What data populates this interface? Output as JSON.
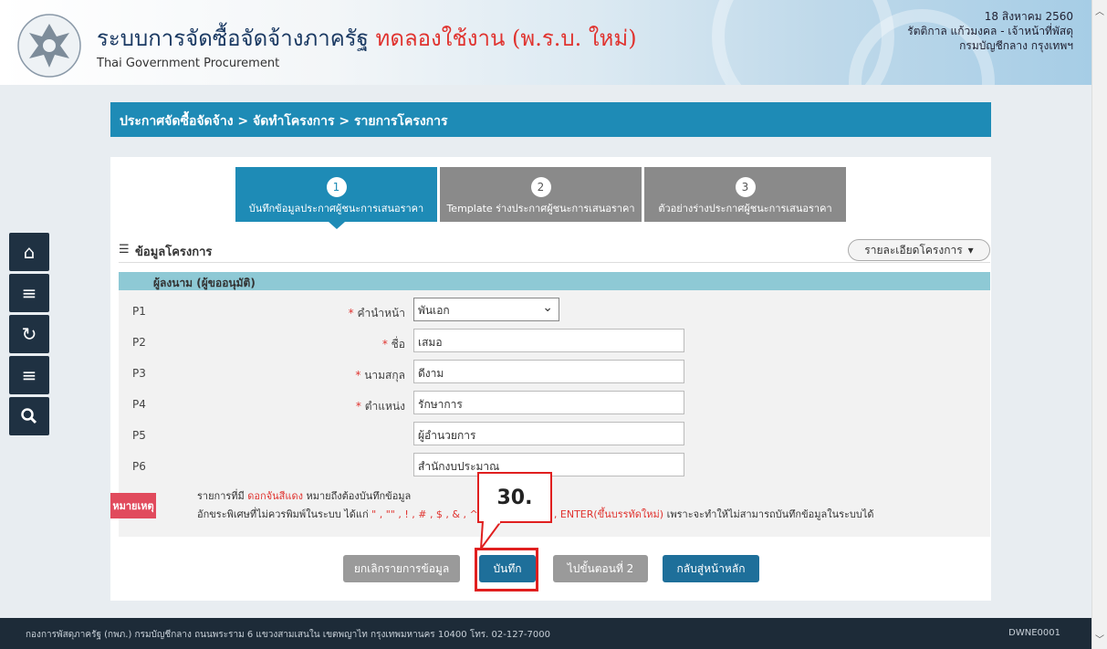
{
  "header": {
    "title": "ระบบการจัดซื้อจัดจ้างภาครัฐ",
    "trial_label": "ทดลองใช้งาน (พ.ร.บ. ใหม่)",
    "subtitle": "Thai Government Procurement",
    "date": "18 สิงหาคม 2560",
    "user": "รัตติกาล แก้วมงคล - เจ้าหน้าที่พัสดุ",
    "department": "กรมบัญชีกลาง กรุงเทพฯ"
  },
  "breadcrumb": "ประกาศจัดซื้อจัดจ้าง > จัดทำโครงการ > รายการโครงการ",
  "steps": [
    {
      "num": "1",
      "label": "บันทึกข้อมูลประกาศผู้ชนะการเสนอราคา"
    },
    {
      "num": "2",
      "label": "Template ร่างประกาศผู้ชนะการเสนอราคา"
    },
    {
      "num": "3",
      "label": "ตัวอย่างร่างประกาศผู้ชนะการเสนอราคา"
    }
  ],
  "section": {
    "title": "ข้อมูลโครงการ",
    "detail_button": "รายละเอียดโครงการ"
  },
  "form": {
    "panel_title": "ผู้ลงนาม (ผู้ขออนุมัติ)",
    "rows": [
      {
        "p": "P1",
        "label": "คำนำหน้า",
        "value": "พันเอก"
      },
      {
        "p": "P2",
        "label": "ชื่อ",
        "value": "เสมอ"
      },
      {
        "p": "P3",
        "label": "นามสกุล",
        "value": "ดีงาม"
      },
      {
        "p": "P4",
        "label": "ตำแหน่ง",
        "value": "รักษาการ"
      },
      {
        "p": "P5",
        "label": "",
        "value": "ผู้อำนวยการ"
      },
      {
        "p": "P6",
        "label": "",
        "value": "สำนักงบประมาณ"
      }
    ]
  },
  "note": {
    "badge": "หมายเหตุ",
    "line1_a": "รายการที่มี",
    "line1_red": "ดอกจันสีแดง",
    "line1_b": "หมายถึงต้องบันทึกข้อมูล",
    "line2_a": "อักขระพิเศษที่ไม่ควรพิมพ์ในระบบ ได้แก่",
    "line2_chars_a": "\" , \"\" , ! , # , $ , & , ^ ,",
    "line2_chars_b": "; , ENTER(ขึ้นบรรทัดใหม่)",
    "line2_b": "เพราะจะทำให้ไม่สามารถบันทึกข้อมูลในระบบได้"
  },
  "buttons": {
    "cancel": "ยกเลิกรายการข้อมูล",
    "save": "บันทึก",
    "next": "ไปขั้นตอนที่ 2",
    "home": "กลับสู่หน้าหลัก"
  },
  "annotation": "30.",
  "footer": {
    "address": "กองการพัสดุภาครัฐ (กพภ.) กรมบัญชีกลาง ถนนพระราม 6 แขวงสามเสนใน เขตพญาไท กรุงเทพมหานคร 10400 โทร. 02-127-7000",
    "code": "DWNE0001"
  },
  "icons": [
    "home-icon",
    "menu-icon",
    "refresh-icon",
    "menu-icon",
    "search-icon"
  ]
}
